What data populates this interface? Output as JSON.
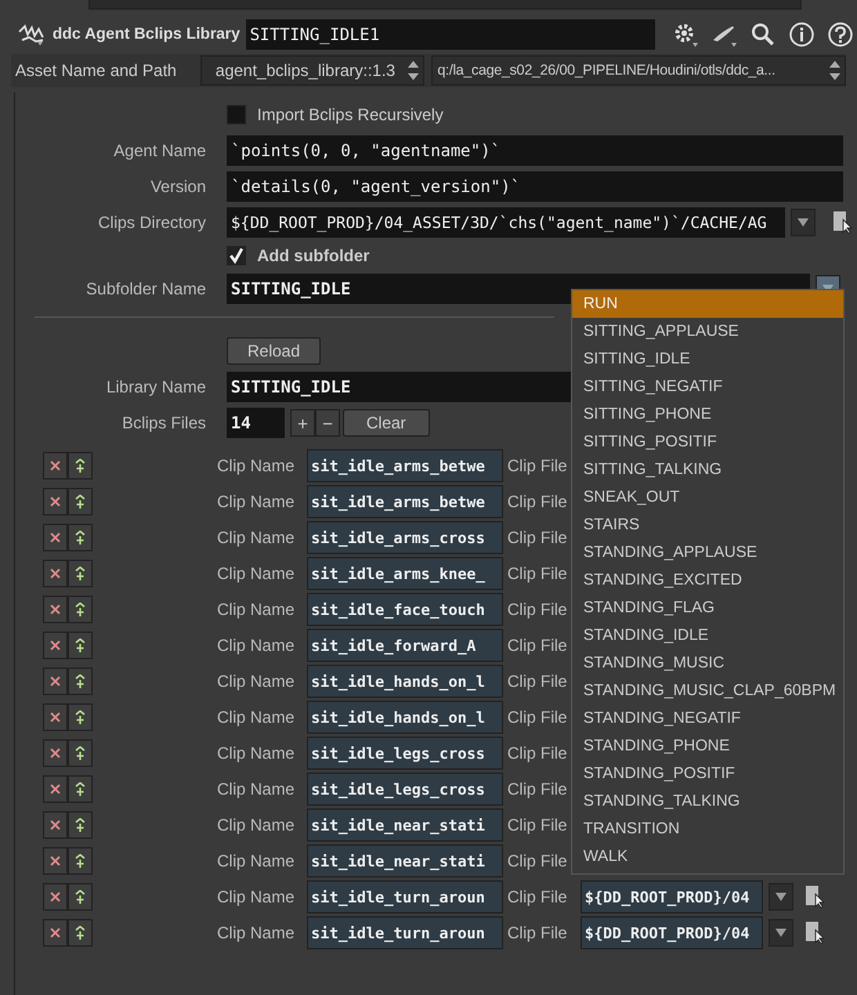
{
  "header": {
    "title": "ddc Agent Bclips Library",
    "node_name": "SITTING_IDLE1"
  },
  "asset": {
    "label": "Asset Name and Path",
    "name": "agent_bclips_library::1.3",
    "path": "q:/la_cage_s02_26/00_PIPELINE/Houdini/otls/ddc_a..."
  },
  "import_recursive": {
    "label": "Import Bclips Recursively",
    "checked": false
  },
  "fields": [
    {
      "label": "Agent Name",
      "value": "`points(0, 0, \"agentname\")`"
    },
    {
      "label": "Version",
      "value": "`details(0, \"agent_version\")`"
    }
  ],
  "clips_directory": {
    "label": "Clips Directory",
    "value": "${DD_ROOT_PROD}/04_ASSET/3D/`chs(\"agent_name\")`/CACHE/AG"
  },
  "add_subfolder": {
    "label": "Add subfolder",
    "checked": true
  },
  "subfolder": {
    "label": "Subfolder Name",
    "value": "SITTING_IDLE"
  },
  "reload": "Reload",
  "library": {
    "label": "Library Name",
    "value": "SITTING_IDLE"
  },
  "bclips_files": {
    "label": "Bclips Files",
    "value": "14",
    "add": "+",
    "remove": "−",
    "clear": "Clear"
  },
  "clips": [
    {
      "name_label": "Clip Name",
      "name": "sit_idle_arms_betwe",
      "file_label": "Clip File"
    },
    {
      "name_label": "Clip Name",
      "name": "sit_idle_arms_betwe",
      "file_label": "Clip File"
    },
    {
      "name_label": "Clip Name",
      "name": "sit_idle_arms_cross",
      "file_label": "Clip File"
    },
    {
      "name_label": "Clip Name",
      "name": "sit_idle_arms_knee_",
      "file_label": "Clip File"
    },
    {
      "name_label": "Clip Name",
      "name": "sit_idle_face_touch",
      "file_label": "Clip File"
    },
    {
      "name_label": "Clip Name",
      "name": "sit_idle_forward_A",
      "file_label": "Clip File"
    },
    {
      "name_label": "Clip Name",
      "name": "sit_idle_hands_on_l",
      "file_label": "Clip File"
    },
    {
      "name_label": "Clip Name",
      "name": "sit_idle_hands_on_l",
      "file_label": "Clip File"
    },
    {
      "name_label": "Clip Name",
      "name": "sit_idle_legs_cross",
      "file_label": "Clip File"
    },
    {
      "name_label": "Clip Name",
      "name": "sit_idle_legs_cross",
      "file_label": "Clip File"
    },
    {
      "name_label": "Clip Name",
      "name": "sit_idle_near_stati",
      "file_label": "Clip File"
    },
    {
      "name_label": "Clip Name",
      "name": "sit_idle_near_stati",
      "file_label": "Clip File"
    },
    {
      "name_label": "Clip Name",
      "name": "sit_idle_turn_aroun",
      "file_label": "Clip File",
      "file": "${DD_ROOT_PROD}/04"
    },
    {
      "name_label": "Clip Name",
      "name": "sit_idle_turn_aroun",
      "file_label": "Clip File",
      "file": "${DD_ROOT_PROD}/04"
    }
  ],
  "dropdown": [
    {
      "label": "RUN",
      "selected": true
    },
    {
      "label": "SITTING_APPLAUSE",
      "selected": false
    },
    {
      "label": "SITTING_IDLE",
      "selected": false
    },
    {
      "label": "SITTING_NEGATIF",
      "selected": false
    },
    {
      "label": "SITTING_PHONE",
      "selected": false
    },
    {
      "label": "SITTING_POSITIF",
      "selected": false
    },
    {
      "label": "SITTING_TALKING",
      "selected": false
    },
    {
      "label": "SNEAK_OUT",
      "selected": false
    },
    {
      "label": "STAIRS",
      "selected": false
    },
    {
      "label": "STANDING_APPLAUSE",
      "selected": false
    },
    {
      "label": "STANDING_EXCITED",
      "selected": false
    },
    {
      "label": "STANDING_FLAG",
      "selected": false
    },
    {
      "label": "STANDING_IDLE",
      "selected": false
    },
    {
      "label": "STANDING_MUSIC",
      "selected": false
    },
    {
      "label": "STANDING_MUSIC_CLAP_60BPM",
      "selected": false
    },
    {
      "label": "STANDING_NEGATIF",
      "selected": false
    },
    {
      "label": "STANDING_PHONE",
      "selected": false
    },
    {
      "label": "STANDING_POSITIF",
      "selected": false
    },
    {
      "label": "STANDING_TALKING",
      "selected": false
    },
    {
      "label": "TRANSITION",
      "selected": false
    },
    {
      "label": "WALK",
      "selected": false
    }
  ]
}
